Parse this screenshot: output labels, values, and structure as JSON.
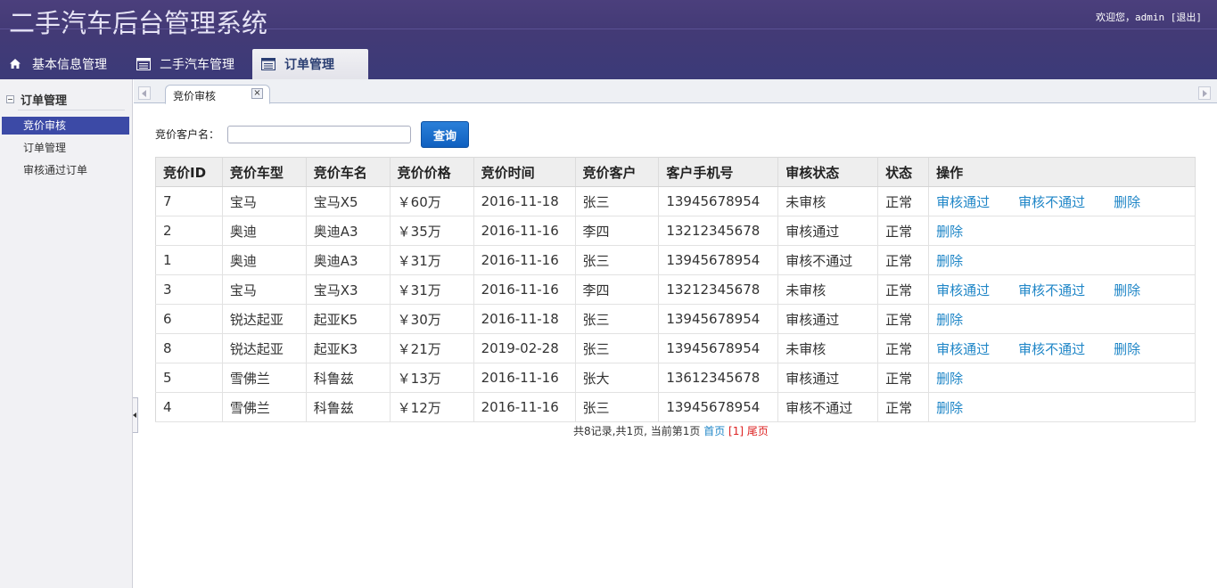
{
  "header": {
    "title": "二手汽车后台管理系统",
    "welcome": "欢迎您，admin",
    "logout": "[退出]"
  },
  "nav": {
    "tabs": [
      {
        "label": "基本信息管理",
        "icon": "home-icon"
      },
      {
        "label": "二手汽车管理",
        "icon": "list-icon"
      },
      {
        "label": "订单管理",
        "icon": "list-icon",
        "active": true
      }
    ]
  },
  "sidebar": {
    "title": "订单管理",
    "items": [
      {
        "label": "竞价审核",
        "active": true
      },
      {
        "label": "订单管理"
      },
      {
        "label": "审核通过订单"
      }
    ]
  },
  "tabstrip": {
    "active_tab": "竞价审核",
    "close": "×"
  },
  "search": {
    "label": "竞价客户名：",
    "value": "",
    "placeholder": "",
    "button": "查询"
  },
  "table": {
    "columns": [
      "竞价ID",
      "竞价车型",
      "竞价车名",
      "竞价价格",
      "竞价时间",
      "竞价客户",
      "客户手机号",
      "审核状态",
      "状态",
      "操作"
    ],
    "rows": [
      {
        "id": "7",
        "type": "宝马",
        "name": "宝马X5",
        "price": "￥60万",
        "time": "2016-11-18",
        "customer": "张三",
        "phone": "13945678954",
        "review": "未审核",
        "status": "正常",
        "ops": [
          "审核通过",
          "审核不通过",
          "删除"
        ]
      },
      {
        "id": "2",
        "type": "奥迪",
        "name": "奥迪A3",
        "price": "￥35万",
        "time": "2016-11-16",
        "customer": "李四",
        "phone": "13212345678",
        "review": "审核通过",
        "status": "正常",
        "ops": [
          "删除"
        ]
      },
      {
        "id": "1",
        "type": "奥迪",
        "name": "奥迪A3",
        "price": "￥31万",
        "time": "2016-11-16",
        "customer": "张三",
        "phone": "13945678954",
        "review": "审核不通过",
        "status": "正常",
        "ops": [
          "删除"
        ]
      },
      {
        "id": "3",
        "type": "宝马",
        "name": "宝马X3",
        "price": "￥31万",
        "time": "2016-11-16",
        "customer": "李四",
        "phone": "13212345678",
        "review": "未审核",
        "status": "正常",
        "ops": [
          "审核通过",
          "审核不通过",
          "删除"
        ]
      },
      {
        "id": "6",
        "type": "锐达起亚",
        "name": "起亚K5",
        "price": "￥30万",
        "time": "2016-11-18",
        "customer": "张三",
        "phone": "13945678954",
        "review": "审核通过",
        "status": "正常",
        "ops": [
          "删除"
        ]
      },
      {
        "id": "8",
        "type": "锐达起亚",
        "name": "起亚K3",
        "price": "￥21万",
        "time": "2019-02-28",
        "customer": "张三",
        "phone": "13945678954",
        "review": "未审核",
        "status": "正常",
        "ops": [
          "审核通过",
          "审核不通过",
          "删除"
        ]
      },
      {
        "id": "5",
        "type": "雪佛兰",
        "name": "科鲁兹",
        "price": "￥13万",
        "time": "2016-11-16",
        "customer": "张大",
        "phone": "13612345678",
        "review": "审核通过",
        "status": "正常",
        "ops": [
          "删除"
        ]
      },
      {
        "id": "4",
        "type": "雪佛兰",
        "name": "科鲁兹",
        "price": "￥12万",
        "time": "2016-11-16",
        "customer": "张三",
        "phone": "13945678954",
        "review": "审核不通过",
        "status": "正常",
        "ops": [
          "删除"
        ]
      }
    ]
  },
  "pager": {
    "summary": "共8记录,共1页, 当前第1页",
    "first": "首页",
    "current": "[1]",
    "last": "尾页"
  },
  "colors": {
    "header_bg": "#433a76",
    "link": "#1f86c7",
    "sidebar_active": "#3c4aa6",
    "button": "#1060c0"
  }
}
